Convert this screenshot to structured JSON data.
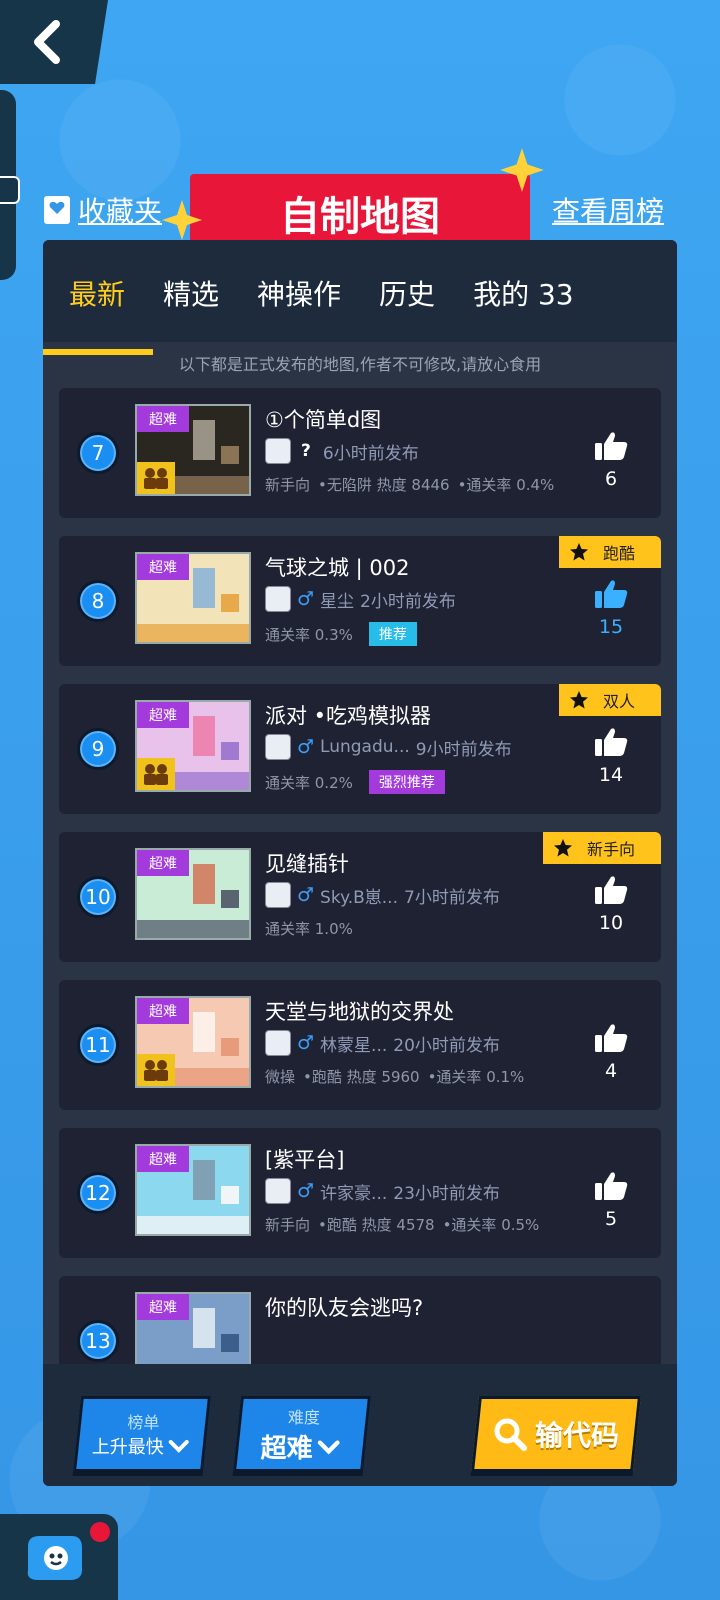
{
  "header": {
    "title": "自制地图",
    "favorites_label": "收藏夹",
    "weekly_label": "查看周榜"
  },
  "tabs": [
    {
      "label": "最新",
      "active": true
    },
    {
      "label": "精选",
      "active": false
    },
    {
      "label": "神操作",
      "active": false
    },
    {
      "label": "历史",
      "active": false
    },
    {
      "label": "我的 33",
      "active": false
    }
  ],
  "notice": "以下都是正式发布的地图,作者不可修改,请放心食用",
  "maps": [
    {
      "rank": "7",
      "difficulty": "超难",
      "duo": true,
      "title": "①个简单d图",
      "author": "?",
      "time": "6小时前发布",
      "meta": [
        "新手向",
        "•无陷阱 热度 8446",
        "•通关率 0.4%"
      ],
      "likes": "6",
      "hot": false,
      "category": "",
      "recommend": "",
      "theme": "dark"
    },
    {
      "rank": "8",
      "difficulty": "超难",
      "duo": false,
      "title": "气球之城 | 002",
      "author": "星尘",
      "time": "2小时前发布",
      "meta": [
        "通关率 0.3%"
      ],
      "likes": "15",
      "hot": true,
      "category": "跑酷",
      "recommend": "推荐",
      "theme": "balloon"
    },
    {
      "rank": "9",
      "difficulty": "超难",
      "duo": true,
      "title": "派对 •吃鸡模拟器",
      "author": "Lungadu...",
      "time": "9小时前发布",
      "meta": [
        "通关率 0.2%"
      ],
      "likes": "14",
      "hot": false,
      "category": "双人",
      "recommend": "强烈推荐",
      "theme": "party"
    },
    {
      "rank": "10",
      "difficulty": "超难",
      "duo": false,
      "title": "见缝插针",
      "author": "Sky.B崽...",
      "time": "7小时前发布",
      "meta": [
        "通关率 1.0%"
      ],
      "likes": "10",
      "hot": false,
      "category": "新手向",
      "recommend": "",
      "theme": "green"
    },
    {
      "rank": "11",
      "difficulty": "超难",
      "duo": true,
      "title": "天堂与地狱的交界处",
      "author": "林蒙星...",
      "time": "20小时前发布",
      "meta": [
        "微操",
        "•跑酷 热度 5960",
        "•通关率 0.1%"
      ],
      "likes": "4",
      "hot": false,
      "category": "",
      "recommend": "",
      "theme": "peach"
    },
    {
      "rank": "12",
      "difficulty": "超难",
      "duo": false,
      "title": "[紫平台]",
      "author": "许家豪...",
      "time": "23小时前发布",
      "meta": [
        "新手向",
        "•跑酷 热度 4578",
        "•通关率 0.5%"
      ],
      "likes": "5",
      "hot": false,
      "category": "",
      "recommend": "",
      "theme": "sky"
    },
    {
      "rank": "13",
      "difficulty": "超难",
      "duo": false,
      "title": "你的队友会逃吗?",
      "author": "",
      "time": "",
      "meta": [],
      "likes": "",
      "hot": false,
      "category": "",
      "recommend": "",
      "theme": "blue"
    }
  ],
  "footer": {
    "rank_label": "榜单",
    "rank_value": "上升最快",
    "difficulty_label": "难度",
    "difficulty_value": "超难",
    "code_label": "输代码"
  },
  "colors": {
    "accent": "#ffcc1c",
    "badge_purple": "#a33bdc",
    "banner_red": "#e8173a",
    "button_blue": "#1e86e8"
  }
}
